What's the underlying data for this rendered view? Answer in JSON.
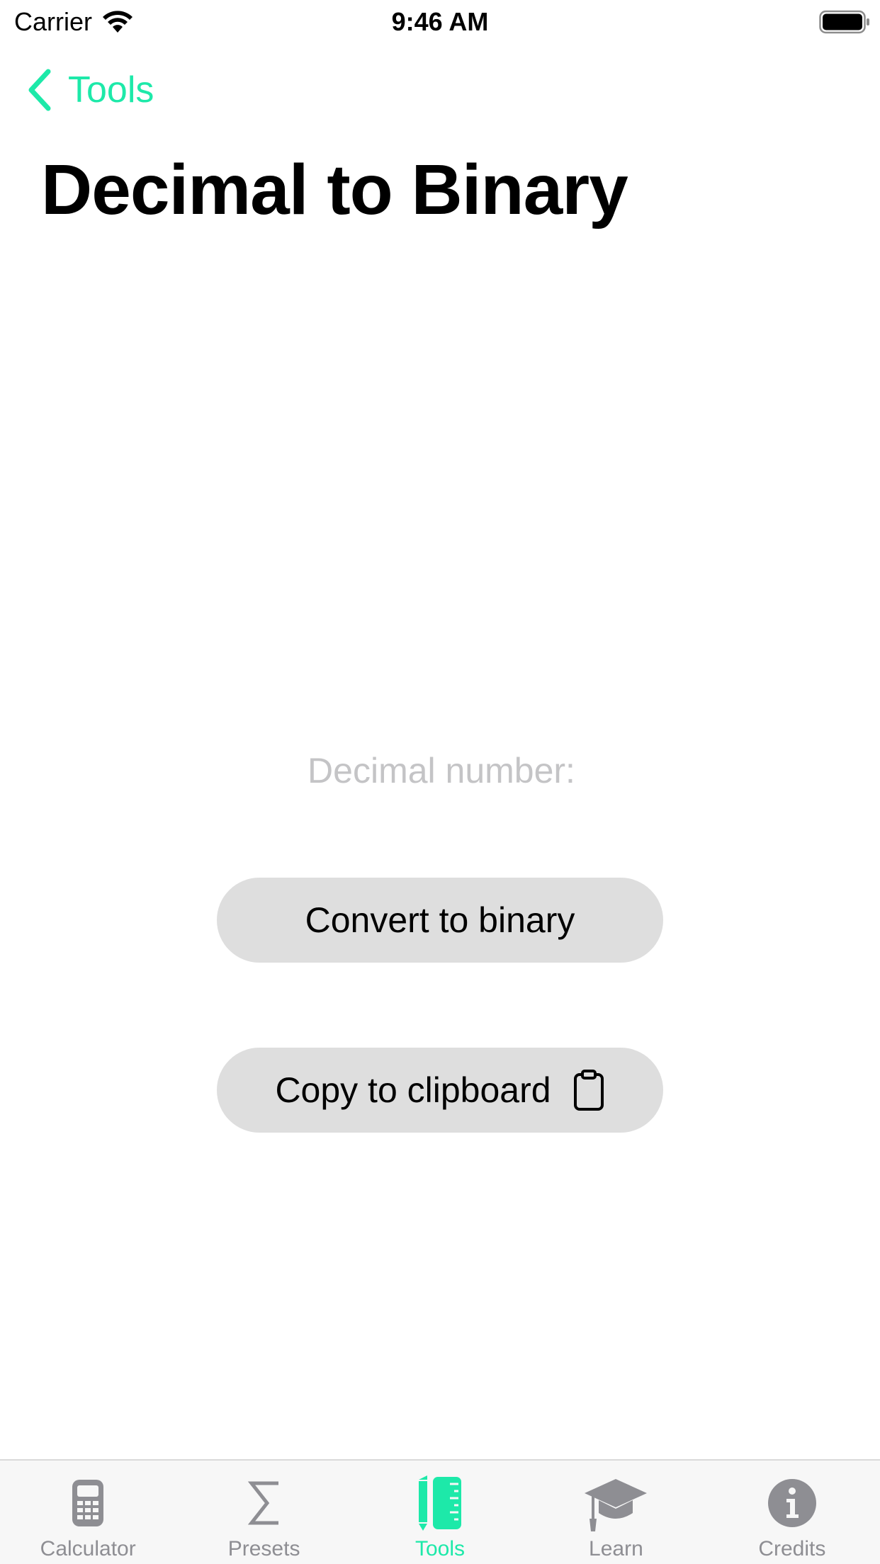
{
  "status_bar": {
    "carrier": "Carrier",
    "time": "9:46 AM"
  },
  "nav": {
    "back_label": "Tools",
    "title": "Decimal to Binary"
  },
  "form": {
    "input_placeholder": "Decimal number:",
    "input_value": "",
    "convert_label": "Convert to binary",
    "copy_label": "Copy to clipboard"
  },
  "tab_bar": {
    "tabs": [
      {
        "label": "Calculator",
        "icon": "calculator-icon",
        "active": false
      },
      {
        "label": "Presets",
        "icon": "sigma-icon",
        "active": false
      },
      {
        "label": "Tools",
        "icon": "ruler-pencil-icon",
        "active": true
      },
      {
        "label": "Learn",
        "icon": "graduation-cap-icon",
        "active": false
      },
      {
        "label": "Credits",
        "icon": "info-icon",
        "active": false
      }
    ]
  },
  "colors": {
    "accent": "#1de9a9",
    "inactive": "#8e8e93",
    "button_bg": "#dedede",
    "placeholder": "#c4c4c6"
  }
}
